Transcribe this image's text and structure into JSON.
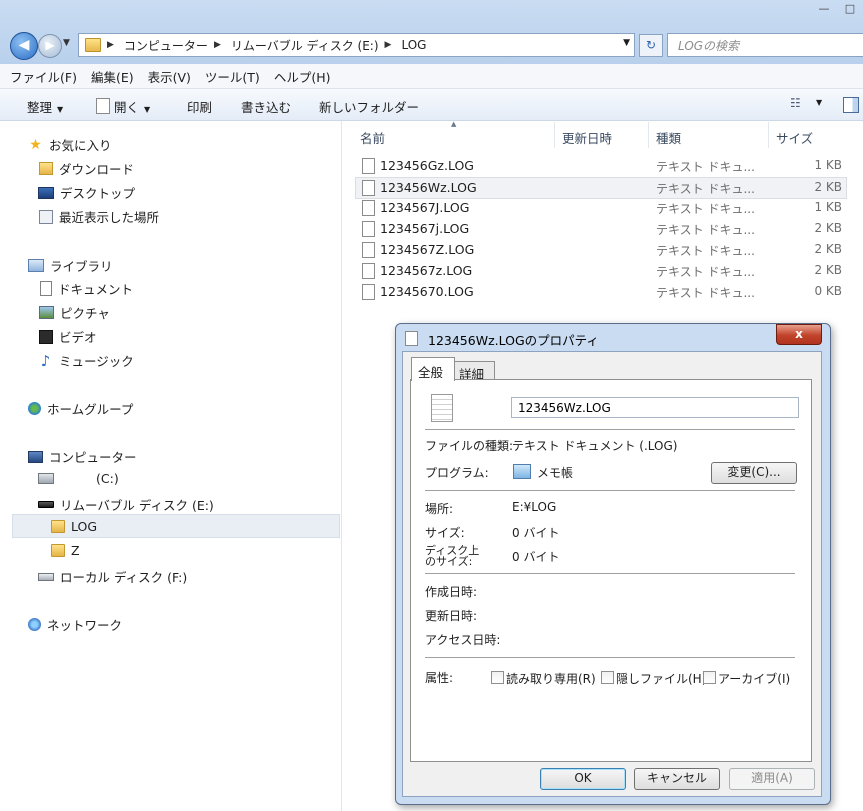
{
  "address": {
    "segments": [
      "コンピューター",
      "リムーバブル ディスク (E:)",
      "LOG"
    ],
    "search_placeholder": "LOGの検索"
  },
  "window_controls": {
    "minimize": "—",
    "maximize": "□"
  },
  "menu": [
    "ファイル(F)",
    "編集(E)",
    "表示(V)",
    "ツール(T)",
    "ヘルプ(H)"
  ],
  "toolbar": {
    "organize": "整理",
    "open": "開く",
    "print": "印刷",
    "burn": "書き込む",
    "new_folder": "新しいフォルダー"
  },
  "nav": {
    "favorites": "お気に入り",
    "downloads": "ダウンロード",
    "desktop": "デスクトップ",
    "recent": "最近表示した場所",
    "libraries": "ライブラリ",
    "documents": "ドキュメント",
    "pictures": "ピクチャ",
    "videos": "ビデオ",
    "music": "ミュージック",
    "homegroup": "ホームグループ",
    "computer": "コンピューター",
    "c_drive": "(C:)",
    "removable": "リムーバブル ディスク (E:)",
    "log": "LOG",
    "z": "Z",
    "local_f": "ローカル ディスク (F:)",
    "network": "ネットワーク"
  },
  "columns": {
    "name": "名前",
    "modified": "更新日時",
    "type": "種類",
    "size": "サイズ"
  },
  "files": [
    {
      "name": "123456Gz.LOG",
      "type": "テキスト ドキュ...",
      "size": "1 KB"
    },
    {
      "name": "123456Wz.LOG",
      "type": "テキスト ドキュ...",
      "size": "2 KB"
    },
    {
      "name": "1234567J.LOG",
      "type": "テキスト ドキュ...",
      "size": "1 KB"
    },
    {
      "name": "1234567j.LOG",
      "type": "テキスト ドキュ...",
      "size": "2 KB"
    },
    {
      "name": "1234567Z.LOG",
      "type": "テキスト ドキュ...",
      "size": "2 KB"
    },
    {
      "name": "1234567z.LOG",
      "type": "テキスト ドキュ...",
      "size": "2 KB"
    },
    {
      "name": "12345670.LOG",
      "type": "テキスト ドキュ...",
      "size": "0 KB"
    }
  ],
  "dialog": {
    "title": "123456Wz.LOGのプロパティ",
    "close": "x",
    "tabs": [
      "全般",
      "詳細"
    ],
    "filename": "123456Wz.LOG",
    "file_type_label": "ファイルの種類:",
    "file_type_value": "テキスト ドキュメント (.LOG)",
    "program_label": "プログラム:",
    "program_value": "メモ帳",
    "change_button": "変更(C)...",
    "location_label": "場所:",
    "location_value": "E:¥LOG",
    "size_label": "サイズ:",
    "size_value": "0 バイト",
    "size_on_disk_label_1": "ディスク上",
    "size_on_disk_label_2": "のサイズ:",
    "size_on_disk_value": "0 バイト",
    "created_label": "作成日時:",
    "modified_label": "更新日時:",
    "accessed_label": "アクセス日時:",
    "attributes_label": "属性:",
    "readonly": "読み取り専用(R)",
    "hidden": "隠しファイル(H)",
    "archive": "アーカイブ(I)",
    "ok": "OK",
    "cancel": "キャンセル",
    "apply": "適用(A)"
  }
}
